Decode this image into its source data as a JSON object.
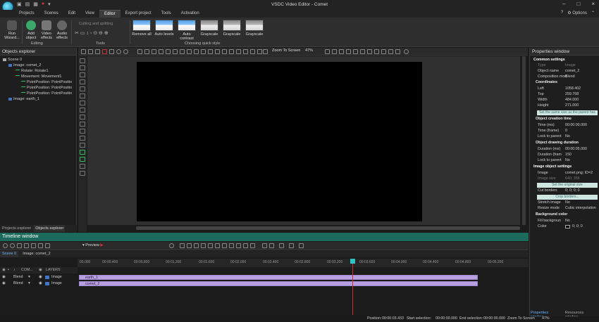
{
  "app": {
    "title": "VSDC Video Editor - Comet",
    "options": "Options"
  },
  "menu": [
    "Projects",
    "Scenes",
    "Edit",
    "View",
    "Editor",
    "Export project",
    "Tools",
    "Activation"
  ],
  "ribbon": {
    "run_wizard": "Run Wizard...",
    "add_object": "Add object",
    "video_effects": "Video effects",
    "audio_effects": "Audio effects",
    "group_editing": "Editing",
    "cutting": "Cutting and splitting",
    "group_tools": "Tools",
    "quick_styles": [
      "Remove all",
      "Auto levels",
      "Auto contrast",
      "Grayscale",
      "Grayscale",
      "Grayscale"
    ],
    "group_quick": "Choosing quick style"
  },
  "objects_explorer": {
    "title": "Objects explorer",
    "nodes": [
      "Scene 0",
      "Image: comet_2",
      "Rotate: Rotate1",
      "Movement: Movement1",
      "PointPosition: PointPositio",
      "PointPosition: PointPositio",
      "PointPosition: PointPositio",
      "Image: earth_1"
    ],
    "tabs": [
      "Projects explorer",
      "Objects explorer"
    ]
  },
  "editor": {
    "zoom_label": "Zoom To Screen",
    "zoom_value": "47%"
  },
  "properties": {
    "title": "Properties window",
    "common": "Common settings",
    "type_k": "Type",
    "type_v": "Image",
    "name_k": "Object name",
    "name_v": "comet_2",
    "comp_k": "Composition mod",
    "comp_v": "Blend",
    "coords": "Coordinates",
    "left_k": "Left",
    "left_v": "1058.402",
    "top_k": "Top",
    "top_v": "259.768",
    "width_k": "Width",
    "width_v": "484.000",
    "height_k": "Height",
    "height_v": "271.000",
    "same_size": "Set the same size as the parent has",
    "creation": "Object creation time",
    "time_ms_k": "Time (ms)",
    "time_ms_v": "00:00:00.000",
    "time_fr_k": "Time (frame)",
    "time_fr_v": "0",
    "lock1_k": "Lock to parent",
    "lock1_v": "No",
    "drawing": "Object drawing duration",
    "dur_ms_k": "Duration (ms)",
    "dur_ms_v": "00:00:05.000",
    "dur_fr_k": "Duration (fram",
    "dur_fr_v": "150",
    "lock2_k": "Lock to parent",
    "lock2_v": "No",
    "image_settings": "Image object settings",
    "image_k": "Image",
    "image_v": "comet.png; ID=2",
    "imgsize_k": "Image size",
    "imgsize_v": "640; 356",
    "orig_size": "Set the original size",
    "cut_k": "Cut borders",
    "cut_v": "0; 0; 0; 0",
    "crop": "Crop borders...",
    "stretch_k": "Stretch image",
    "stretch_v": "No",
    "resize_k": "Resize mode",
    "resize_v": "Cubic interpolation",
    "bgcolor": "Background color",
    "fill_k": "Fill backgroun",
    "fill_v": "No",
    "color_k": "Color",
    "color_v": "0; 0; 0",
    "tabs": [
      "Properties window",
      "Resources window"
    ]
  },
  "timeline": {
    "title": "Timeline window",
    "preview": "Preview",
    "tabs": [
      "Scene 0",
      "Image: comet_2"
    ],
    "header": [
      "COM...",
      "LAYERS"
    ],
    "ticks": [
      "00.000",
      "00:00.400",
      "00:00.800",
      "00:01.200",
      "00:01.600",
      "00:02.000",
      "00:02.400",
      "00:02.800",
      "00:03.200",
      "00:03.600",
      "00:04.000",
      "00:04.400",
      "00:04.800",
      "00:05.200"
    ],
    "tracks": [
      {
        "blend": "Blend",
        "layer": "Image",
        "clip": "earth_1"
      },
      {
        "blend": "Blend",
        "layer": "Image",
        "clip": "comet_2"
      }
    ]
  },
  "status": {
    "position_k": "Position:",
    "position_v": "00:00:03.433",
    "start_k": "Start selection:",
    "start_v": "00:00:00.000",
    "end_k": "End selection:",
    "end_v": "00:00:00.000",
    "zoom_k": "Zoom To Screen",
    "zoom_v": "47%"
  }
}
